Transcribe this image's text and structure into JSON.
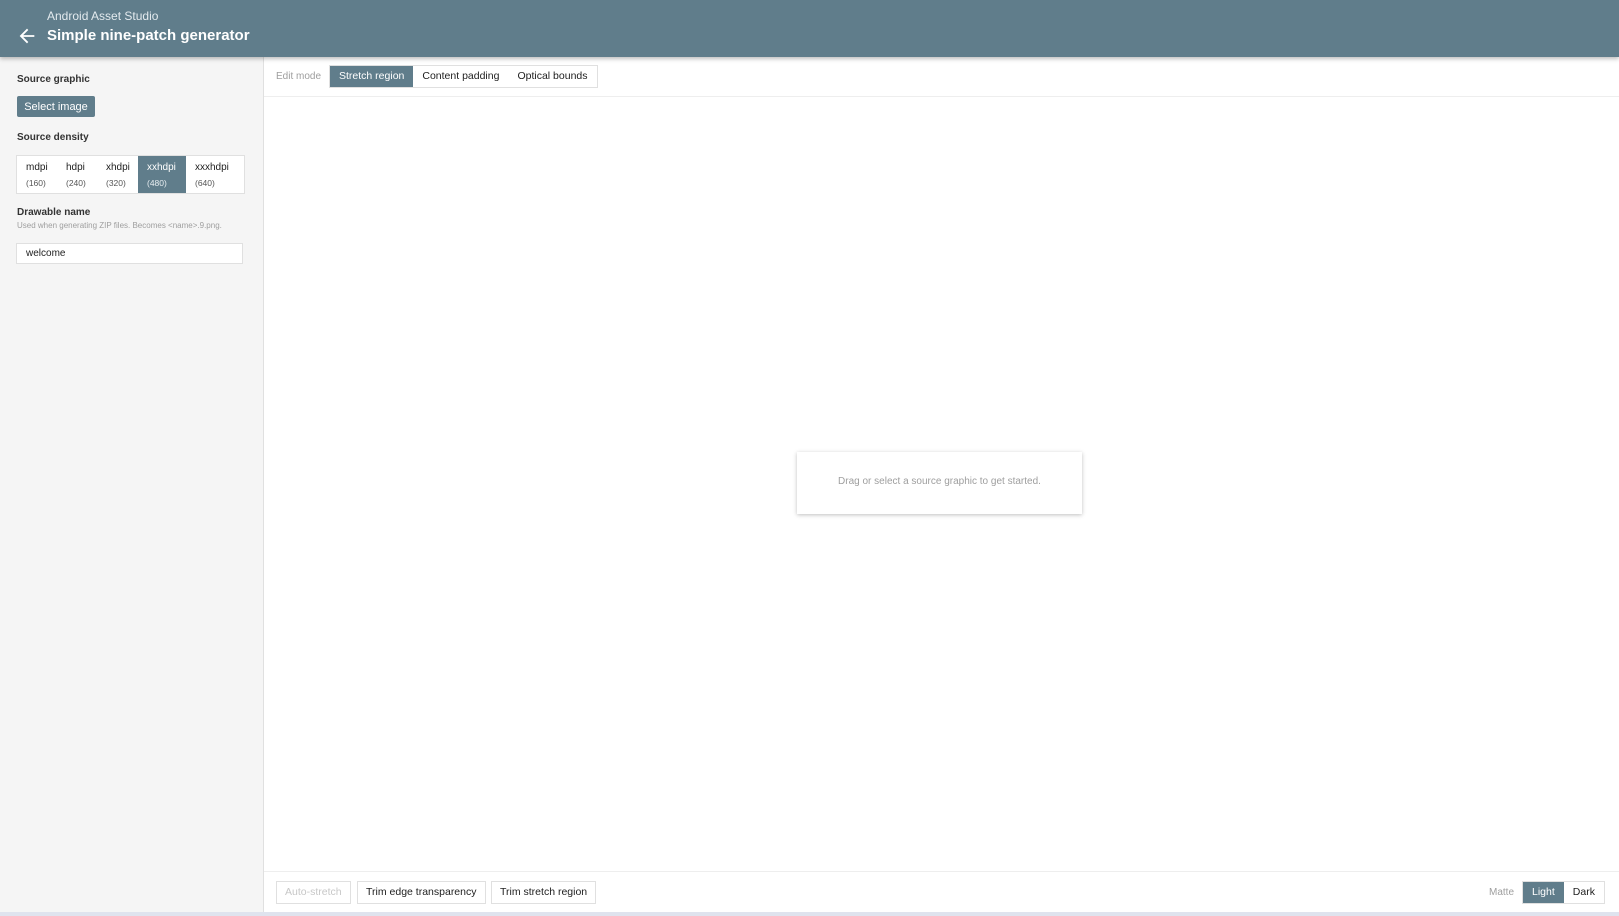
{
  "header": {
    "subtitle": "Android Asset Studio",
    "title": "Simple nine-patch generator",
    "back_icon": "arrow-left-icon"
  },
  "sidebar": {
    "source_graphic_label": "Source graphic",
    "select_image_label": "Select image",
    "source_density_label": "Source density",
    "densities": [
      {
        "name": "mdpi",
        "dpi": "(160)",
        "selected": false
      },
      {
        "name": "hdpi",
        "dpi": "(240)",
        "selected": false
      },
      {
        "name": "xhdpi",
        "dpi": "(320)",
        "selected": false
      },
      {
        "name": "xxhdpi",
        "dpi": "(480)",
        "selected": true
      },
      {
        "name": "xxxhdpi",
        "dpi": "(640)",
        "selected": false
      }
    ],
    "drawable_name_label": "Drawable name",
    "drawable_name_help": "Used when generating ZIP files. Becomes <name>.9.png.",
    "drawable_name_value": "welcome"
  },
  "main": {
    "edit_mode_label": "Edit mode",
    "modes": [
      {
        "label": "Stretch region",
        "selected": true
      },
      {
        "label": "Content padding",
        "selected": false
      },
      {
        "label": "Optical bounds",
        "selected": false
      }
    ],
    "empty_message": "Drag or select a source graphic to get started.",
    "actions": {
      "auto_stretch": "Auto-stretch",
      "trim_edge": "Trim edge transparency",
      "trim_stretch": "Trim stretch region"
    },
    "matte_label": "Matte",
    "matte_options": [
      {
        "label": "Light",
        "selected": true
      },
      {
        "label": "Dark",
        "selected": false
      }
    ]
  },
  "colors": {
    "accent": "#607d8b",
    "background": "#f5f5f5"
  }
}
